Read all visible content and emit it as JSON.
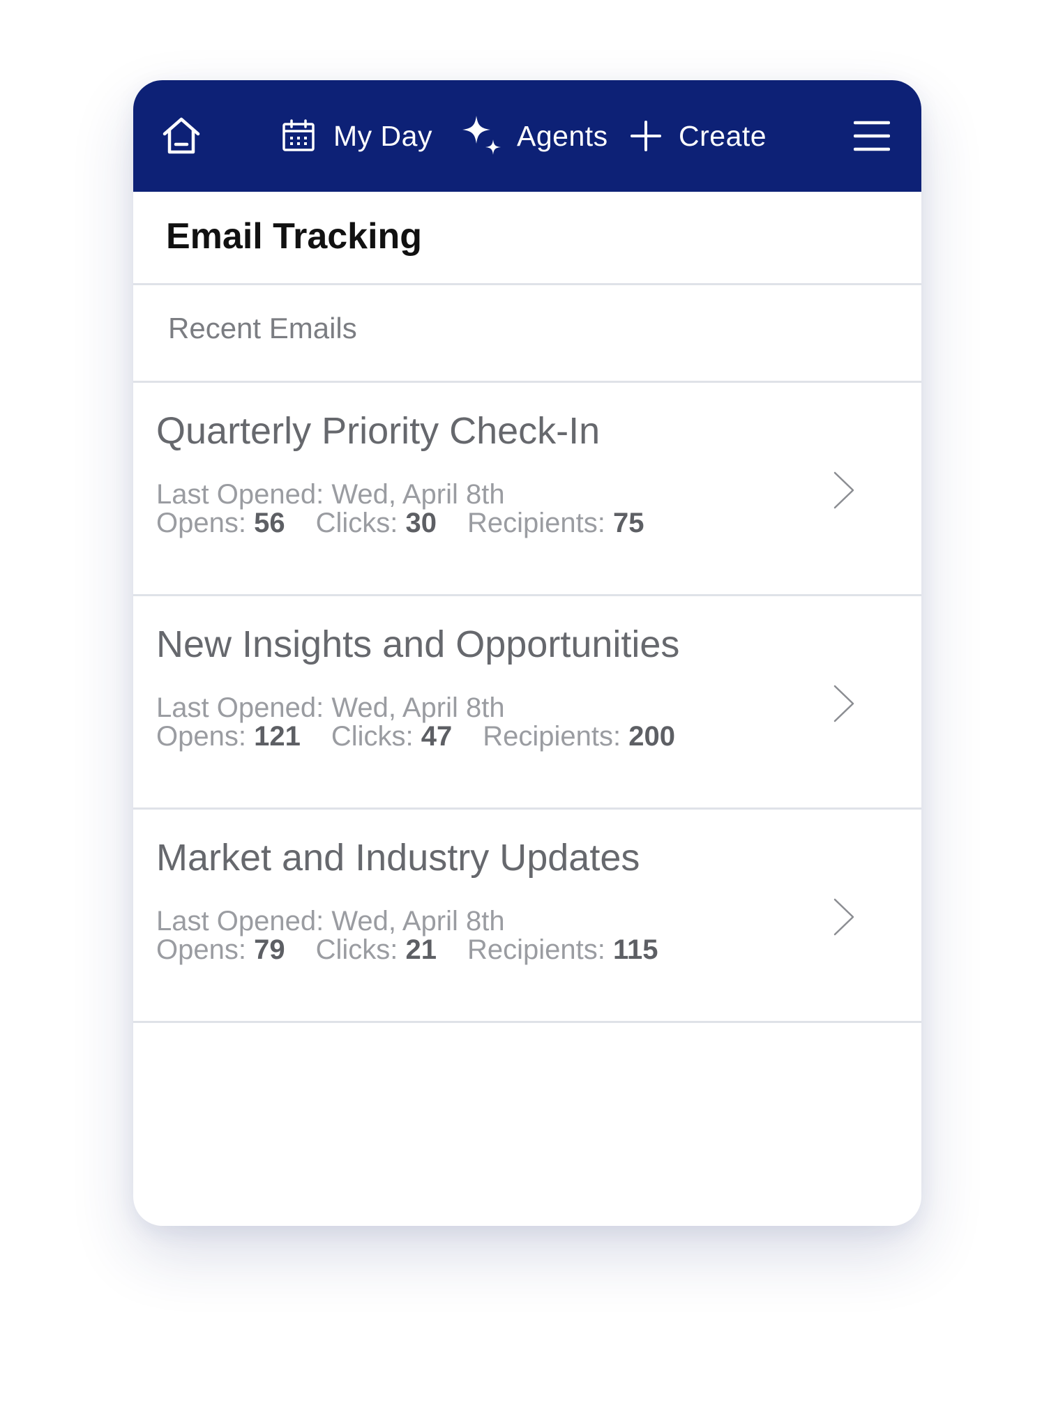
{
  "nav": {
    "home_icon": "home-icon",
    "my_day": {
      "icon": "calendar-icon",
      "label": "My Day"
    },
    "agents": {
      "icon": "sparkle-icon",
      "label": "Agents"
    },
    "create": {
      "icon": "plus-icon",
      "label": "Create"
    },
    "menu_icon": "hamburger-menu-icon",
    "background_color": "#0d2176"
  },
  "page": {
    "title": "Email Tracking",
    "section_label": "Recent Emails"
  },
  "labels": {
    "last_opened": "Last Opened:",
    "opens": "Opens:",
    "clicks": "Clicks:",
    "recipients": "Recipients:"
  },
  "emails": [
    {
      "subject": "Quarterly Priority Check-In",
      "last_opened": "Wed, April 8th",
      "opens": "56",
      "clicks": "30",
      "recipients": "75"
    },
    {
      "subject": "New Insights and Opportunities",
      "last_opened": "Wed, April 8th",
      "opens": "121",
      "clicks": "47",
      "recipients": "200"
    },
    {
      "subject": "Market and Industry Updates",
      "last_opened": "Wed, April 8th",
      "opens": "79",
      "clicks": "21",
      "recipients": "115"
    }
  ]
}
